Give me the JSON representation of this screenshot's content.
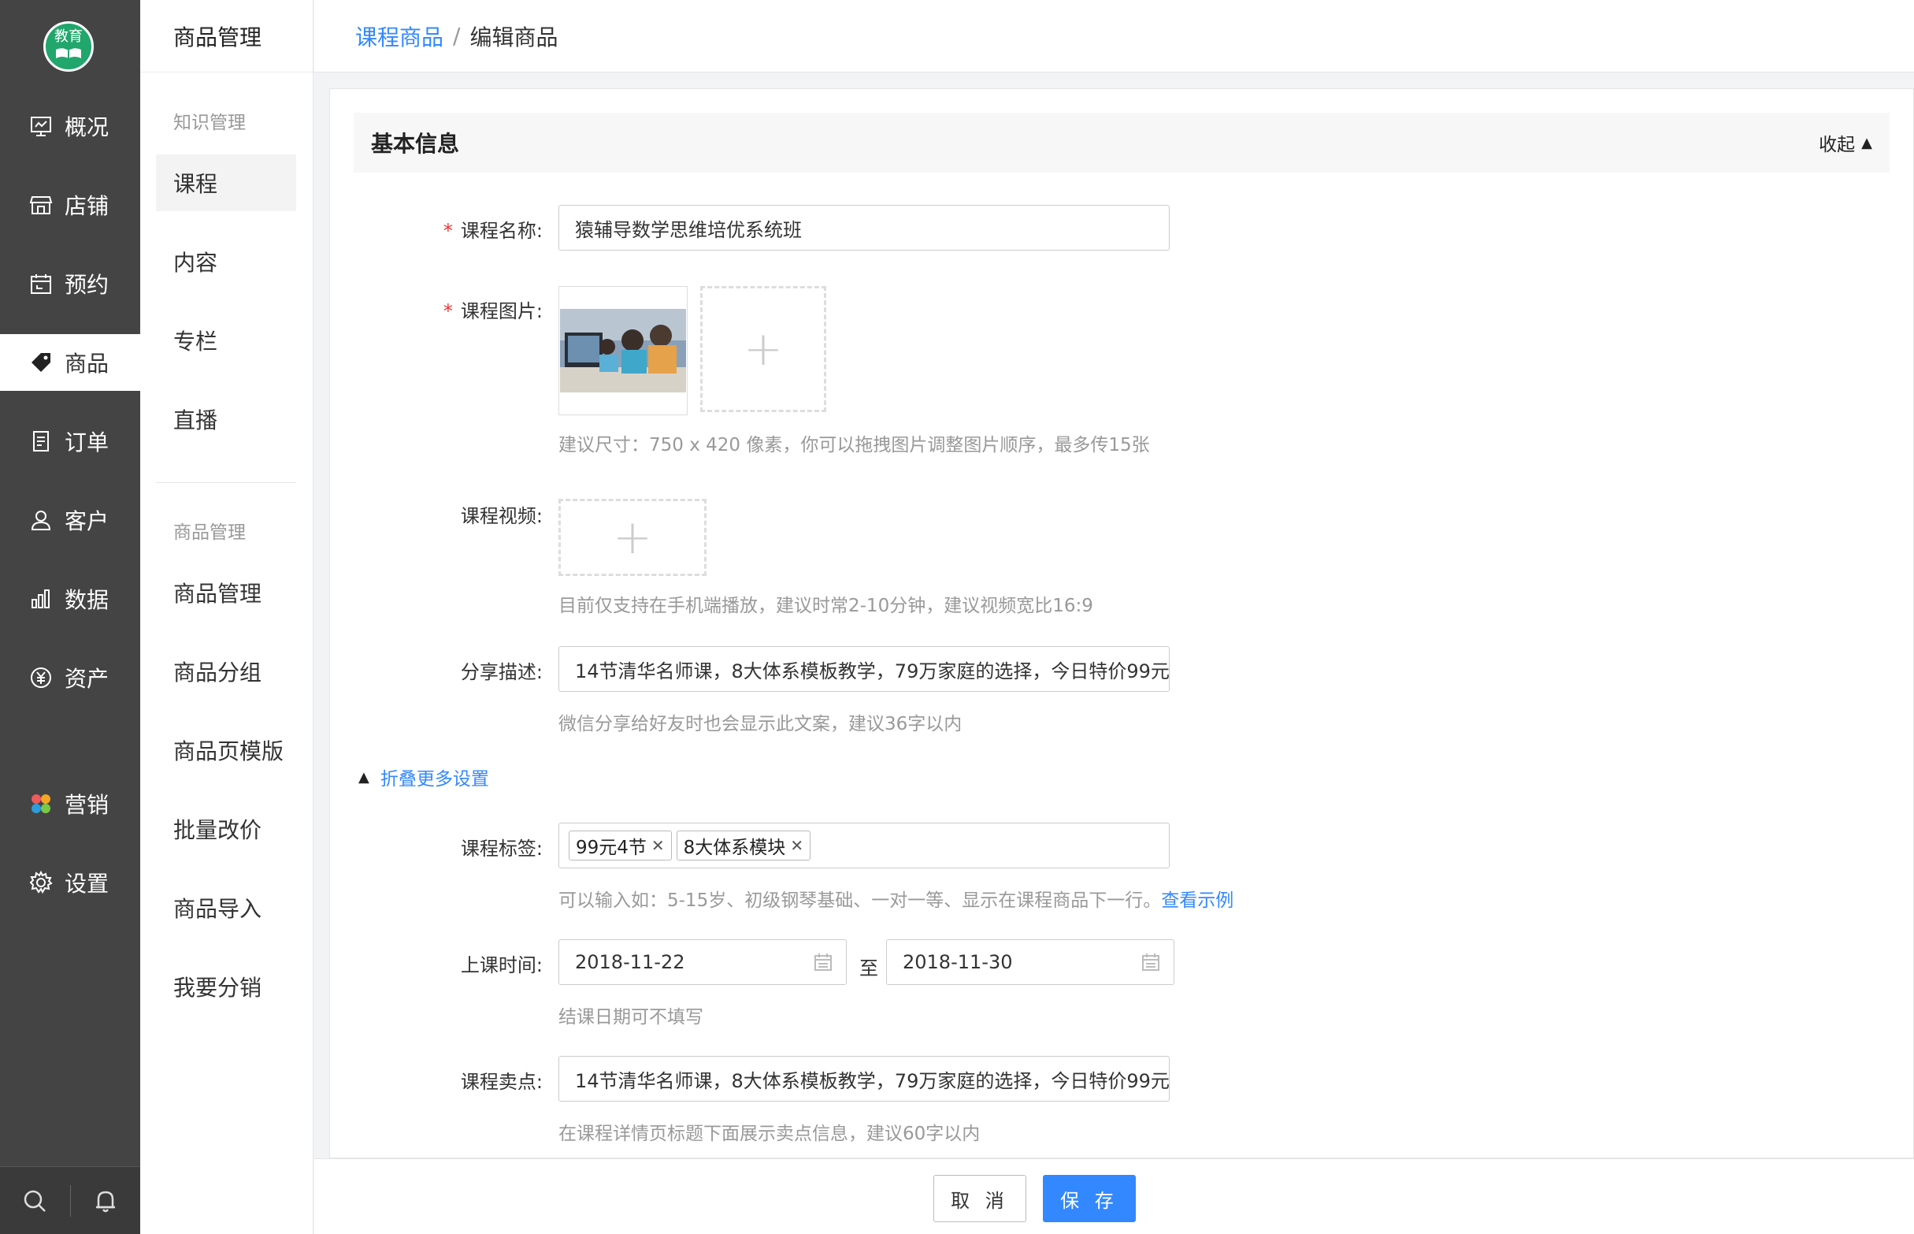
{
  "app": {
    "logo_text": "教育"
  },
  "primary_nav": {
    "items": [
      {
        "label": "概况",
        "icon": "dashboard-icon"
      },
      {
        "label": "店铺",
        "icon": "store-icon"
      },
      {
        "label": "预约",
        "icon": "calendar-icon"
      },
      {
        "label": "商品",
        "icon": "tag-icon",
        "active": true
      },
      {
        "label": "订单",
        "icon": "order-icon"
      },
      {
        "label": "客户",
        "icon": "user-icon"
      },
      {
        "label": "数据",
        "icon": "chart-icon"
      },
      {
        "label": "资产",
        "icon": "yuan-icon"
      },
      {
        "label": "营销",
        "icon": "marketing-icon"
      },
      {
        "label": "设置",
        "icon": "gear-icon"
      }
    ],
    "bottom": [
      "search-icon",
      "bell-icon"
    ]
  },
  "secondary_nav": {
    "title": "商品管理",
    "group1": "知识管理",
    "group1_items": [
      "课程",
      "内容",
      "专栏",
      "直播"
    ],
    "group2": "商品管理",
    "group2_items": [
      "商品管理",
      "商品分组",
      "商品页模版",
      "批量改价",
      "商品导入",
      "我要分销"
    ]
  },
  "breadcrumb": {
    "parent": "课程商品",
    "separator": "/",
    "current": "编辑商品"
  },
  "section": {
    "title": "基本信息",
    "collapse": "收起"
  },
  "form": {
    "name_label": "课程名称:",
    "name_value": "猿辅导数学思维培优系统班",
    "image_label": "课程图片:",
    "image_hint": "建议尺寸：750 x 420 像素，你可以拖拽图片调整图片顺序，最多传15张",
    "video_label": "课程视频:",
    "video_hint": "目前仅支持在手机端播放，建议时常2-10分钟，建议视频宽比16:9",
    "share_label": "分享描述:",
    "share_value": "14节清华名师课，8大体系模板教学，79万家庭的选择，今日特价99元",
    "share_hint": "微信分享给好友时也会显示此文案，建议36字以内",
    "more_settings": "折叠更多设置",
    "tags_label": "课程标签:",
    "tags": [
      "99元4节",
      "8大体系模块"
    ],
    "tags_hint": "可以输入如：5-15岁、初级钢琴基础、一对一等、显示在课程商品下一行。",
    "tags_example": "查看示例",
    "time_label": "上课时间:",
    "start_date": "2018-11-22",
    "to": "至",
    "end_date": "2018-11-30",
    "time_hint": "结课日期可不填写",
    "selling_label": "课程卖点:",
    "selling_value": "14节清华名师课，8大体系模板教学，79万家庭的选择，今日特价99元",
    "selling_hint": "在课程详情页标题下面展示卖点信息，建议60字以内",
    "required_mark": "*"
  },
  "footer": {
    "cancel": "取 消",
    "save": "保 存"
  },
  "colors": {
    "accent": "#3388ff",
    "sidebar": "#444444",
    "logo": "#21a66c",
    "required": "#ee3333"
  }
}
